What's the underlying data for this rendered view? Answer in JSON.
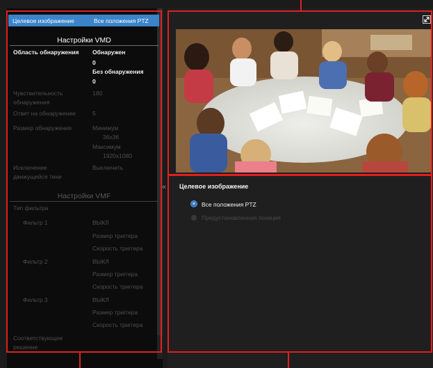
{
  "target_bar": {
    "label": "Целевое изображение",
    "value": "Все положения PTZ"
  },
  "vmd": {
    "header": "Настройки VMD",
    "rows": [
      {
        "label": "Область обнаружения",
        "values": [
          "Обнаружен",
          "0",
          "Без обнаружения",
          "0"
        ],
        "enabled": true
      },
      {
        "label": [
          "Чувствительность",
          "обнаружения"
        ],
        "values": [
          "180"
        ],
        "enabled": false
      },
      {
        "label": "Ответ на обнаружение",
        "values": [
          "5"
        ],
        "enabled": false
      },
      {
        "label": "Размер обнаружения",
        "values": [
          "Минимум",
          "36x36",
          "Максимум",
          "1920x1080"
        ],
        "enabled": false
      },
      {
        "label": [
          "Исключение",
          "движущейся тени"
        ],
        "values": [
          "Выключить"
        ],
        "enabled": false
      }
    ]
  },
  "vmf": {
    "header": "Настройки VMF",
    "filter_type_label": "Тип фильтра",
    "filters": [
      {
        "name": "Фильтр 1",
        "state": "ВЫКЛ",
        "size_label": "Размер триггера",
        "speed_label": "Скорость триггера"
      },
      {
        "name": "Фильтр 2",
        "state": "ВЫКЛ",
        "size_label": "Размер триггера",
        "speed_label": "Скорость триггера"
      },
      {
        "name": "Фильтр 3",
        "state": "ВЫКЛ",
        "size_label": "Размер триггера",
        "speed_label": "Скорость триггера"
      }
    ],
    "match_label": [
      "Соответствующее",
      "решение"
    ]
  },
  "collapse_glyph": "«",
  "right": {
    "title": "Целевое изображение",
    "options": [
      {
        "label": "Все положения PTZ",
        "selected": true,
        "enabled": true
      },
      {
        "label": "Предустановленная позиция",
        "selected": false,
        "enabled": false
      }
    ]
  },
  "icons": {
    "expand": "expand-icon",
    "radio": "radio-icon"
  },
  "colors": {
    "accent": "#3b84c9",
    "annotation": "#e02020",
    "panel": "#0c0c0c",
    "disabled_text": "#4e4e4e"
  }
}
